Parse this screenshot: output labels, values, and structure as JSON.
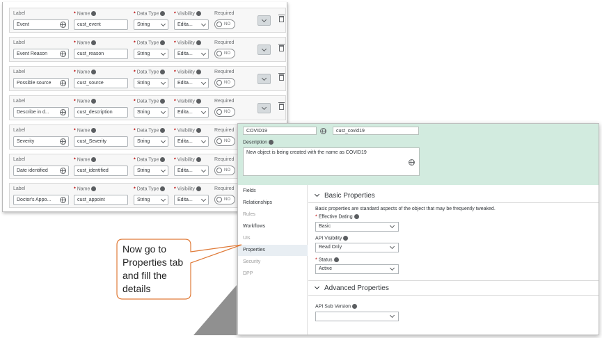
{
  "field_headers": {
    "label": "Label",
    "name": "Name",
    "data_type": "Data Type",
    "visibility": "Visibility",
    "required": "Required"
  },
  "field_rows": [
    {
      "label": "Event",
      "name": "cust_event",
      "data_type": "String",
      "visibility": "Edita...",
      "required": "NO"
    },
    {
      "label": "Event Reason",
      "name": "cust_reason",
      "data_type": "String",
      "visibility": "Edita...",
      "required": "NO"
    },
    {
      "label": "Possible source",
      "name": "cust_source",
      "data_type": "String",
      "visibility": "Edita...",
      "required": "NO"
    },
    {
      "label": "Describe in d...",
      "name": "cust_description",
      "data_type": "String",
      "visibility": "Edita...",
      "required": "NO"
    },
    {
      "label": "Severity",
      "name": "cust_Severity",
      "data_type": "String",
      "visibility": "Edita...",
      "required": "NO"
    },
    {
      "label": "Date identified",
      "name": "cust_identified",
      "data_type": "String",
      "visibility": "Edita...",
      "required": "NO"
    },
    {
      "label": "Doctor's Appo...",
      "name": "cust_appoint",
      "data_type": "String",
      "visibility": "Edita...",
      "required": "NO"
    }
  ],
  "object_header": {
    "label_value": "COVID19",
    "code_value": "cust_covid19",
    "description_label": "Description",
    "description_value": "New object is being created with the name as COVID19"
  },
  "side_nav": {
    "items": [
      "Fields",
      "Relationships",
      "Rules",
      "Workflows",
      "UIs",
      "Properties",
      "Security",
      "DPP"
    ],
    "active": "Properties"
  },
  "basic_properties": {
    "title": "Basic Properties",
    "note": "Basic properties are standard aspects of the object that may be frequently tweaked.",
    "effective_dating_label": "Effective Dating",
    "effective_dating_value": "Basic",
    "api_visibility_label": "API Visibility",
    "api_visibility_value": "Read Only",
    "status_label": "Status",
    "status_value": "Active"
  },
  "advanced_properties": {
    "title": "Advanced Properties",
    "api_sub_version_label": "API Sub Version",
    "api_sub_version_value": ""
  },
  "callout": {
    "text": "Now go to Properties tab and fill the details"
  },
  "colors": {
    "green_header": "#d2ebdf",
    "required_star": "#bb0000",
    "callout_border": "#e07b39"
  }
}
